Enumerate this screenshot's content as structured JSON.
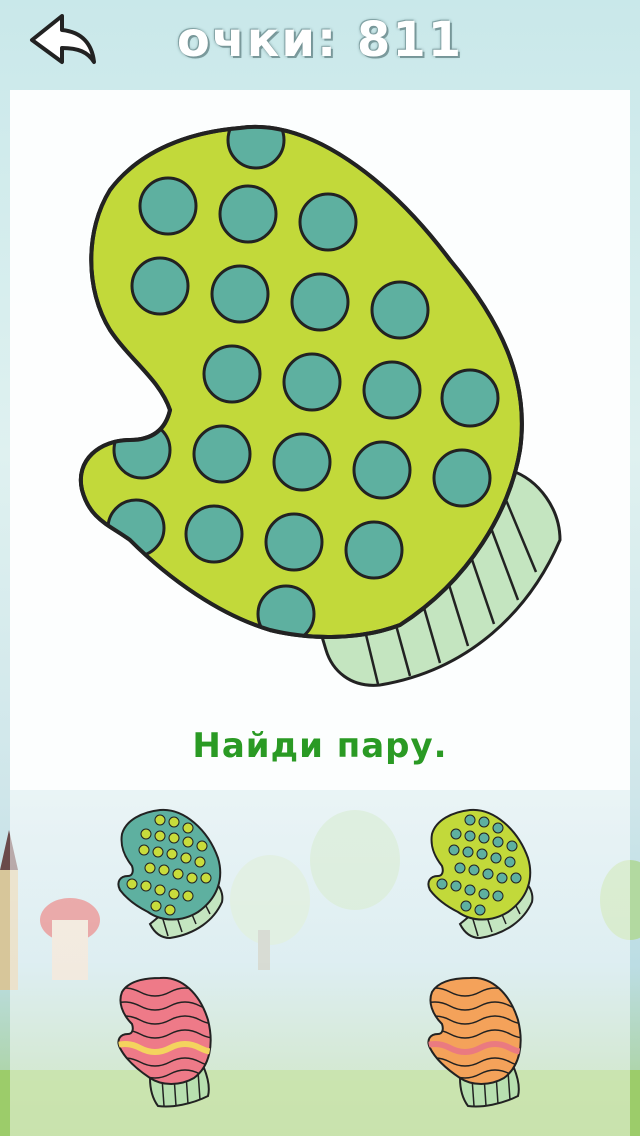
{
  "header": {
    "score_text": "очки: 811",
    "back_icon": "back-arrow-icon"
  },
  "instruction": "Найди пару.",
  "target": {
    "name": "green-mitten-teal-dots",
    "body_color": "#c2d93a",
    "dot_color": "#5eb0a0",
    "cuff_color": "#c4e5c0"
  },
  "choices": [
    {
      "id": "teal-mitten-yellow-dots",
      "body_color": "#5eb0a0",
      "dot_color": "#c8dc3c",
      "cuff_color": "#c4e5c0"
    },
    {
      "id": "green-mitten-teal-dots",
      "body_color": "#c2d93a",
      "dot_color": "#5eb0a0",
      "cuff_color": "#c4e5c0"
    },
    {
      "id": "pink-mitten-waves",
      "body_color": "#ee7a88",
      "wave_color": "#f4d35e",
      "cuff_color": "#b8e0b0"
    },
    {
      "id": "orange-mitten-waves",
      "body_color": "#f4a25a",
      "wave_color": "#ea7a80",
      "cuff_color": "#b8e0b0"
    }
  ]
}
